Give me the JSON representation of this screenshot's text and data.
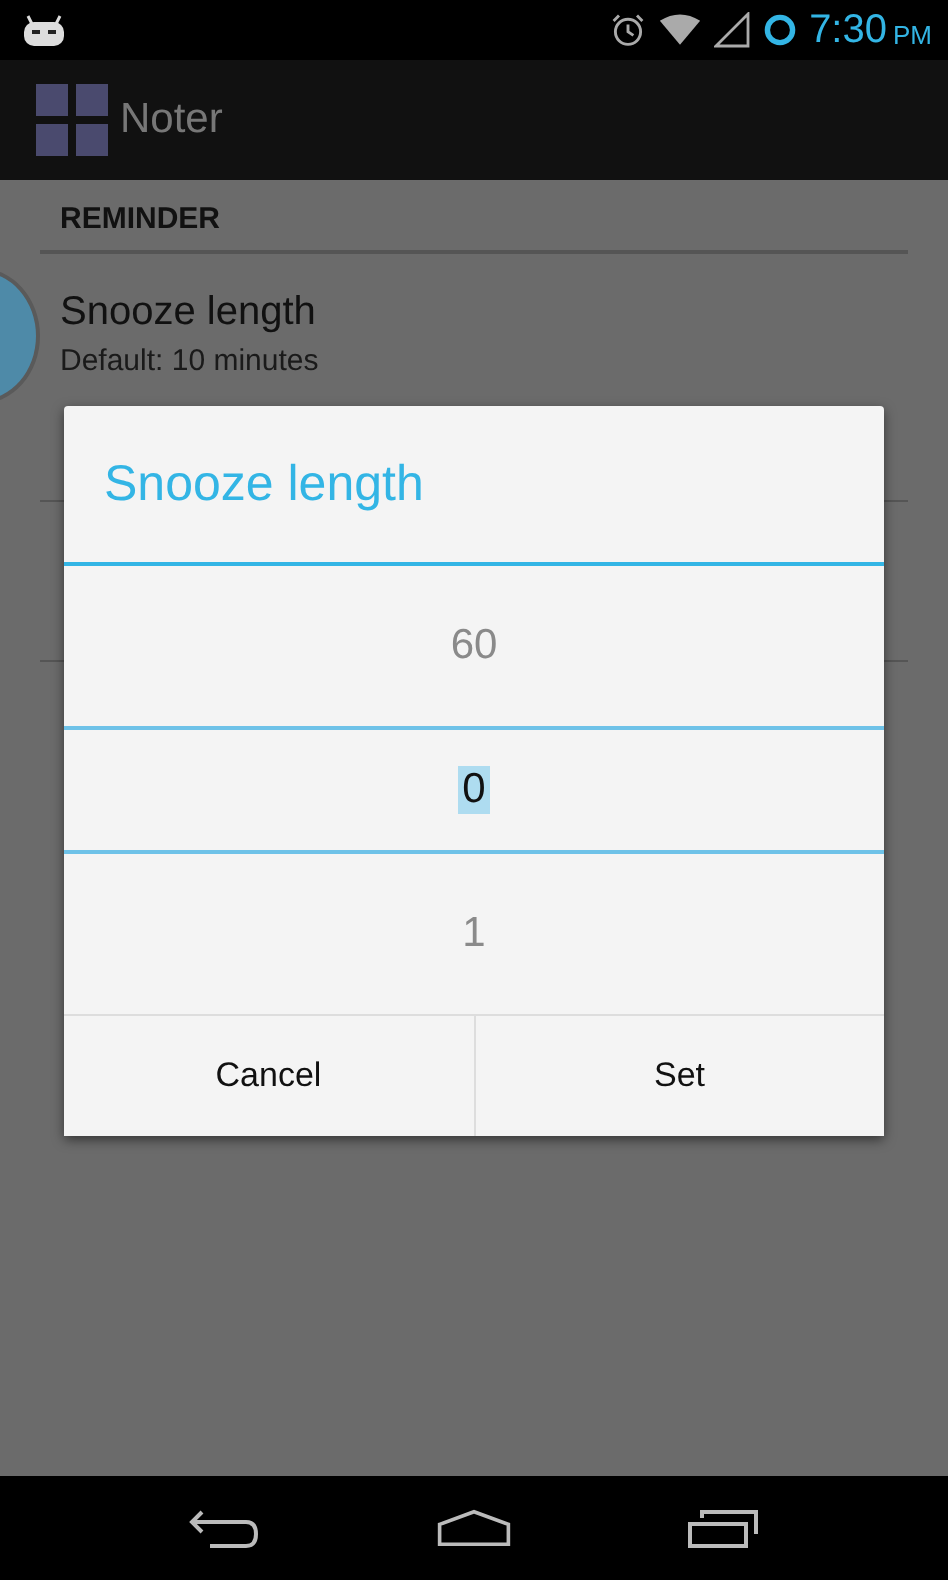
{
  "status_bar": {
    "time": "7:30",
    "period": "PM"
  },
  "action_bar": {
    "title": "Noter"
  },
  "settings": {
    "section": "REMINDER",
    "items": [
      {
        "title": "Snooze length",
        "summary": "Default: 10 minutes"
      }
    ]
  },
  "dialog": {
    "title": "Snooze length",
    "picker": [
      {
        "value": "60",
        "selected": false
      },
      {
        "value": "0",
        "selected": true
      },
      {
        "value": "1",
        "selected": false
      }
    ],
    "buttons": [
      "Cancel",
      "Set"
    ]
  }
}
